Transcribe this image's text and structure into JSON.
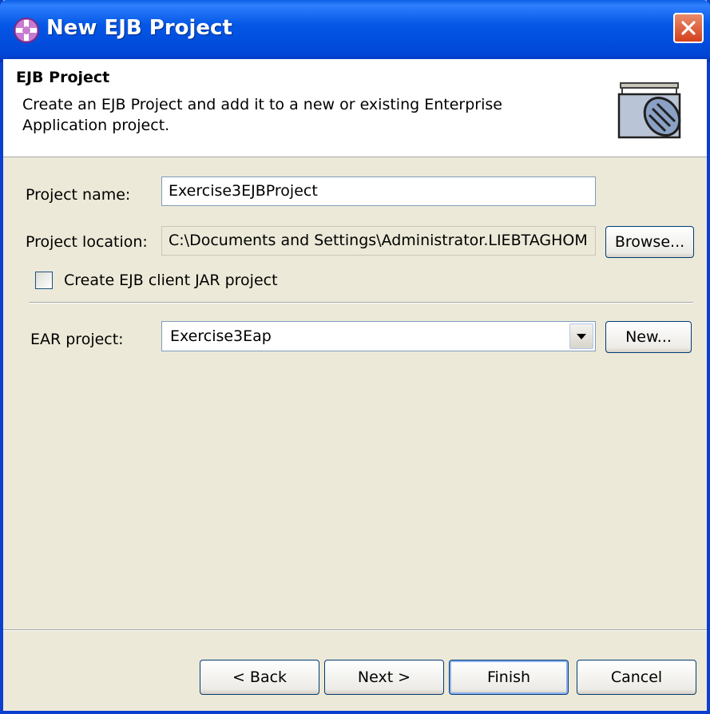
{
  "window": {
    "title": "New EJB Project",
    "colors": {
      "titlebar": "#0457e6",
      "close": "#d5411c",
      "face": "#ece9d8"
    }
  },
  "banner": {
    "title": "EJB Project",
    "description": "Create an EJB Project and add it to a new or existing Enterprise Application project.",
    "icon": "ejb-project-icon"
  },
  "form": {
    "project_name_label": "Project name:",
    "project_name_value": "Exercise3EJBProject",
    "project_location_label": "Project location:",
    "project_location_value": "C:\\Documents and Settings\\Administrator.LIEBTAGHOM",
    "browse_label": "Browse...",
    "client_jar_label": "Create EJB client JAR project",
    "client_jar_checked": false,
    "ear_label": "EAR project:",
    "ear_value": "Exercise3Eap",
    "new_label": "New..."
  },
  "footer": {
    "back_label": "< Back",
    "next_label": "Next >",
    "finish_label": "Finish",
    "cancel_label": "Cancel"
  }
}
